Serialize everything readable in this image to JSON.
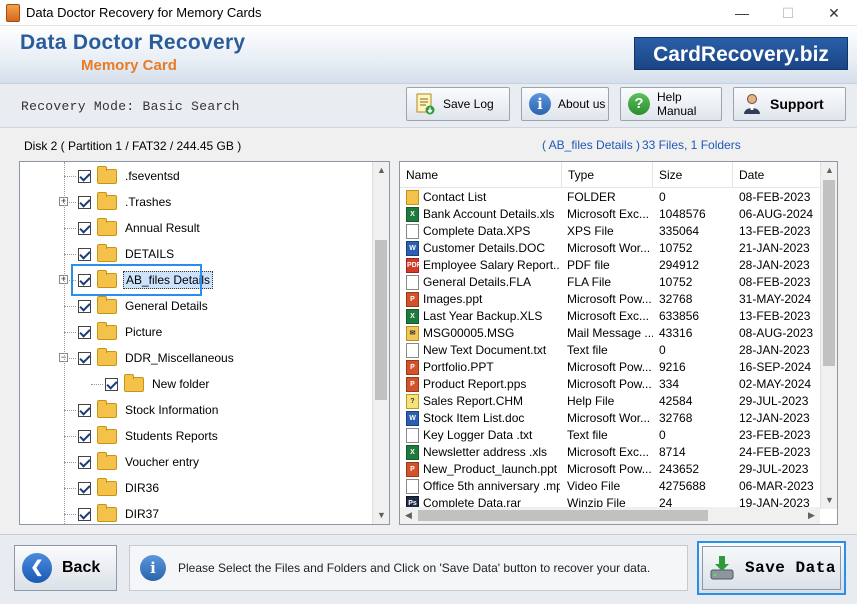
{
  "window": {
    "title": "Data Doctor Recovery for Memory Cards",
    "min": "—",
    "max": "☐",
    "close": "✕"
  },
  "header": {
    "brand_title": "Data Doctor Recovery",
    "brand_subtitle": "Memory Card",
    "brand_link": "CardRecovery.biz"
  },
  "toolbar": {
    "mode_label": "Recovery Mode: Basic Search",
    "save_log": "Save Log",
    "about_us": "About us",
    "help_manual": "Help Manual",
    "support": "Support"
  },
  "info": {
    "disk": "Disk 2 ( Partition 1 / FAT32 / 244.45 GB )",
    "selected": "( AB_files Details )",
    "count": "33 Files, 1 Folders"
  },
  "tree": {
    "items": [
      {
        "label": ".fseventsd",
        "level": 0,
        "expander": ""
      },
      {
        "label": ".Trashes",
        "level": 0,
        "expander": "+"
      },
      {
        "label": "Annual Result",
        "level": 0,
        "expander": ""
      },
      {
        "label": "DETAILS",
        "level": 0,
        "expander": ""
      },
      {
        "label": "AB_files Details",
        "level": 0,
        "expander": "+",
        "selected": true
      },
      {
        "label": "General Details",
        "level": 0,
        "expander": ""
      },
      {
        "label": "Picture",
        "level": 0,
        "expander": ""
      },
      {
        "label": "DDR_Miscellaneous",
        "level": 0,
        "expander": "−"
      },
      {
        "label": "New folder",
        "level": 1,
        "expander": ""
      },
      {
        "label": "Stock Information",
        "level": 0,
        "expander": ""
      },
      {
        "label": "Students Reports",
        "level": 0,
        "expander": ""
      },
      {
        "label": "Voucher entry",
        "level": 0,
        "expander": ""
      },
      {
        "label": "DIR36",
        "level": 0,
        "expander": ""
      },
      {
        "label": "DIR37",
        "level": 0,
        "expander": ""
      }
    ]
  },
  "files": {
    "columns": [
      "Name",
      "Type",
      "Size",
      "Date"
    ],
    "rows": [
      {
        "name": "Contact List",
        "type": "FOLDER",
        "size": "0",
        "date": "08-FEB-2023",
        "icon": "folder"
      },
      {
        "name": "Bank Account Details.xls",
        "type": "Microsoft Exc...",
        "size": "1048576",
        "date": "06-AUG-2024",
        "icon": "excel"
      },
      {
        "name": "Complete Data.XPS",
        "type": "XPS File",
        "size": "335064",
        "date": "13-FEB-2023",
        "icon": "doc"
      },
      {
        "name": "Customer Details.DOC",
        "type": "Microsoft Wor...",
        "size": "10752",
        "date": "21-JAN-2023",
        "icon": "word"
      },
      {
        "name": "Employee Salary Report....",
        "type": "PDF file",
        "size": "294912",
        "date": "28-JAN-2023",
        "icon": "pdf"
      },
      {
        "name": "General Details.FLA",
        "type": "FLA File",
        "size": "10752",
        "date": "08-FEB-2023",
        "icon": "doc"
      },
      {
        "name": "Images.ppt",
        "type": "Microsoft Pow...",
        "size": "32768",
        "date": "31-MAY-2024",
        "icon": "ppt"
      },
      {
        "name": "Last Year Backup.XLS",
        "type": "Microsoft Exc...",
        "size": "633856",
        "date": "13-FEB-2023",
        "icon": "excel"
      },
      {
        "name": "MSG00005.MSG",
        "type": "Mail Message ...",
        "size": "43316",
        "date": "08-AUG-2023",
        "icon": "mail"
      },
      {
        "name": "New Text Document.txt",
        "type": "Text file",
        "size": "0",
        "date": "28-JAN-2023",
        "icon": "doc"
      },
      {
        "name": "Portfolio.PPT",
        "type": "Microsoft Pow...",
        "size": "9216",
        "date": "16-SEP-2024",
        "icon": "ppt"
      },
      {
        "name": "Product Report.pps",
        "type": "Microsoft Pow...",
        "size": "334",
        "date": "02-MAY-2024",
        "icon": "ppt"
      },
      {
        "name": "Sales Report.CHM",
        "type": "Help File",
        "size": "42584",
        "date": "29-JUL-2023",
        "icon": "help"
      },
      {
        "name": "Stock Item List.doc",
        "type": "Microsoft Wor...",
        "size": "32768",
        "date": "12-JAN-2023",
        "icon": "word"
      },
      {
        "name": "Key Logger Data .txt",
        "type": "Text file",
        "size": "0",
        "date": "23-FEB-2023",
        "icon": "doc"
      },
      {
        "name": "Newsletter address .xls",
        "type": "Microsoft Exc...",
        "size": "8714",
        "date": "24-FEB-2023",
        "icon": "excel"
      },
      {
        "name": "New_Product_launch.ppt",
        "type": "Microsoft Pow...",
        "size": "243652",
        "date": "29-JUL-2023",
        "icon": "ppt"
      },
      {
        "name": "Office 5th anniversary .mp4",
        "type": "Video File",
        "size": "4275688",
        "date": "06-MAR-2023",
        "icon": "doc"
      },
      {
        "name": "Complete Data.rar",
        "type": "Winzip File",
        "size": "24",
        "date": "19-JAN-2023",
        "icon": "ps"
      }
    ]
  },
  "footer": {
    "back": "Back",
    "message": "Please Select the Files and Folders and Click on 'Save Data' button to recover your data.",
    "save_data": "Save Data"
  },
  "colors": {
    "brand_blue": "#2b5c9a",
    "brand_orange": "#e97b25",
    "link_blue": "#1f58b8",
    "selection_border": "#2b8ee8"
  }
}
